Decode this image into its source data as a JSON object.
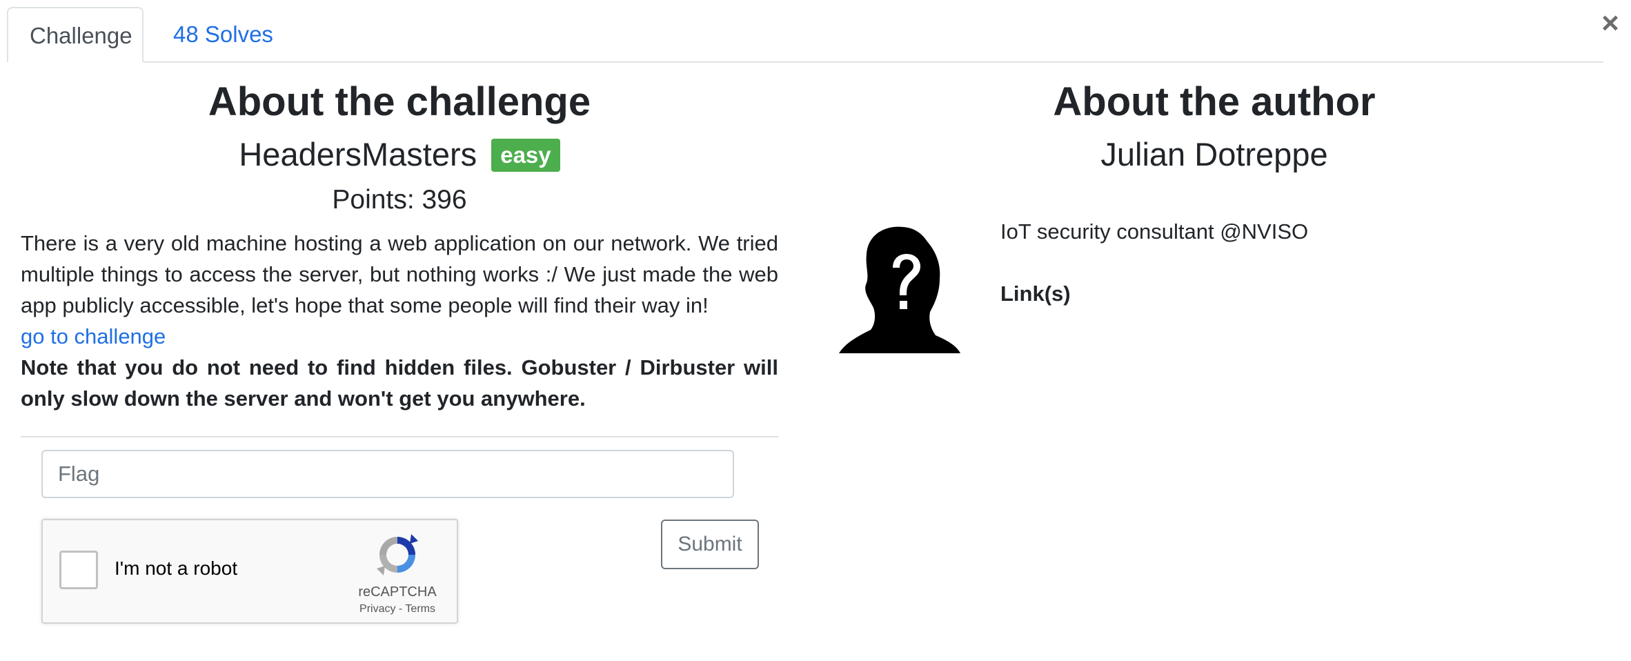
{
  "tabs": {
    "challenge_label": "Challenge",
    "solves_label": "48 Solves"
  },
  "close_icon": "close-icon",
  "challenge": {
    "heading": "About the challenge",
    "name": "HeadersMasters",
    "difficulty": "easy",
    "points": "Points: 396",
    "description": "There is a very old machine hosting a web application on our network. We tried multiple things to access the server, but nothing works :/ We just made the web app publicly accessible, let's hope that some people will find their way in!",
    "link_label": "go to challenge",
    "note": "Note that you do not need to find hidden files. Gobuster / Dirbuster will only slow down the server and won't get you anywhere."
  },
  "form": {
    "flag_placeholder": "Flag",
    "captcha_label": "I'm not a robot",
    "captcha_brand": "reCAPTCHA",
    "captcha_links": "Privacy - Terms",
    "submit_label": "Submit"
  },
  "author": {
    "heading": "About the author",
    "name": "Julian Dotreppe",
    "bio": "IoT security consultant @NVISO",
    "links_label": "Link(s)"
  },
  "colors": {
    "link": "#1f6fe5",
    "badge": "#4cae4c",
    "text": "#212529"
  }
}
